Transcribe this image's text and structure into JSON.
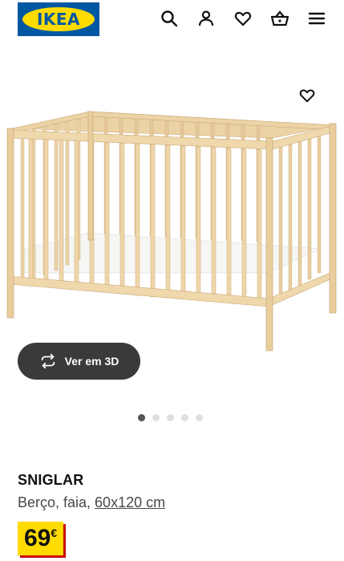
{
  "header": {
    "logo_text": "IKEA",
    "icons": [
      "search-icon",
      "account-icon",
      "heart-icon",
      "basket-icon",
      "menu-icon"
    ]
  },
  "gallery": {
    "favorite_icon": "heart-icon",
    "view_3d_label": "Ver em 3D",
    "dots_count": 5,
    "active_dot": 0
  },
  "product": {
    "name": "SNIGLAR",
    "description_prefix": "Berço, faia, ",
    "size_link": "60x120 cm",
    "price_amount": "69",
    "price_currency": "€"
  },
  "colors": {
    "ikea_blue": "#0058a3",
    "ikea_yellow": "#ffdb00",
    "price_shadow": "#cc0008",
    "button_dark": "#3a3a3a"
  }
}
